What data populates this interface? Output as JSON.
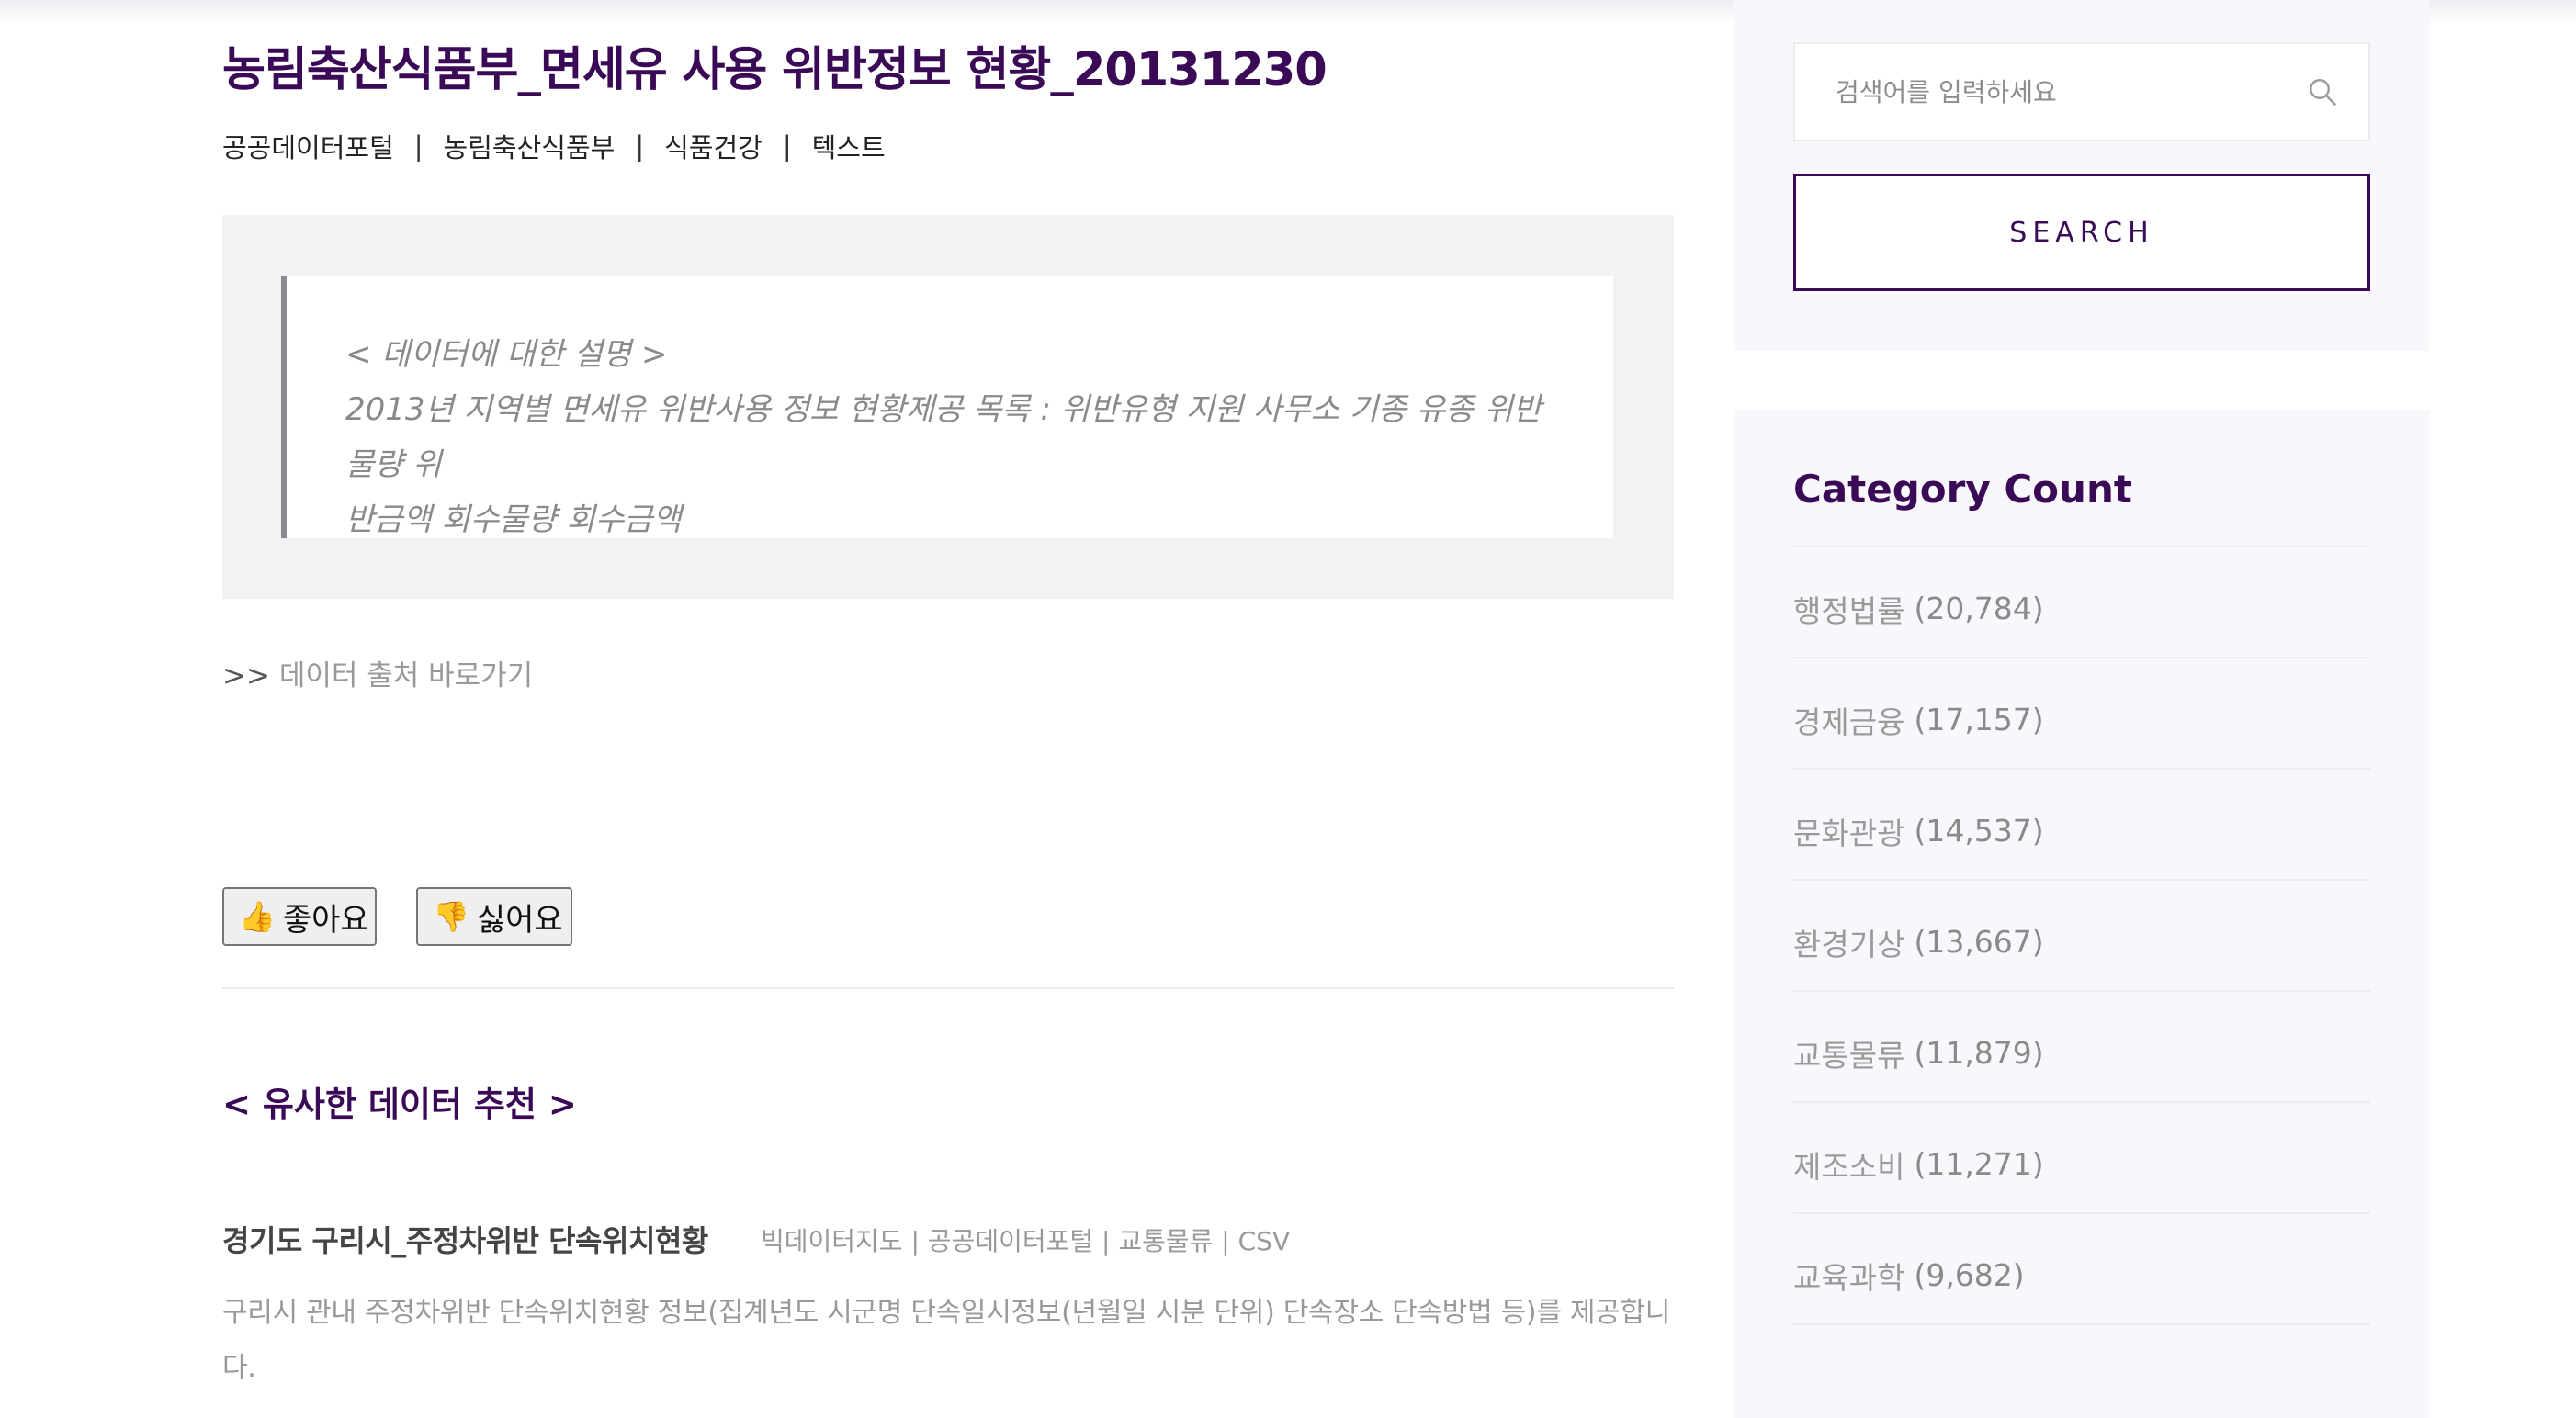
{
  "post": {
    "title": "농림축산식품부_면세유 사용 위반정보 현황_20131230",
    "meta": [
      "공공데이터포털",
      "농림축산식품부",
      "식품건강",
      "텍스트"
    ],
    "meta_separator": "|",
    "description_heading": "< 데이터에 대한 설명 >",
    "description_line1": "2013년 지역별 면세유 위반사용 정보 현황제공 목록 : 위반유형 지원 사무소 기종 유종 위반물량 위",
    "description_line2": "반금액 회수물량 회수금액",
    "source_arrow": ">>",
    "source_label": "데이터 출처 바로가기",
    "like_icon": "👍",
    "like_label": "좋아요",
    "dislike_icon": "👎",
    "dislike_label": "싫어요"
  },
  "recommend": {
    "heading": "< 유사한 데이터 추천 >",
    "items": [
      {
        "title": "경기도 구리시_주정차위반 단속위치현황",
        "meta": "빅데이터지도 | 공공데이터포털 | 교통물류 | CSV",
        "desc": "구리시 관내 주정차위반 단속위치현황 정보(집계년도 시군명 단속일시정보(년월일 시분 단위) 단속장소 단속방법 등)를 제공합니다."
      }
    ]
  },
  "sidebar": {
    "search": {
      "placeholder": "검색어를 입력하세요",
      "value": "",
      "button_label": "SEARCH",
      "icon": "search-icon"
    },
    "category": {
      "title": "Category Count",
      "items": [
        {
          "name": "행정법률",
          "count": "(20,784)"
        },
        {
          "name": "경제금융",
          "count": "(17,157)"
        },
        {
          "name": "문화관광",
          "count": "(14,537)"
        },
        {
          "name": "환경기상",
          "count": "(13,667)"
        },
        {
          "name": "교통물류",
          "count": "(11,879)"
        },
        {
          "name": "제조소비",
          "count": "(11,271)"
        },
        {
          "name": "교육과학",
          "count": "(9,682)"
        }
      ]
    }
  },
  "colors": {
    "accent": "#3a0a57",
    "panel": "#f8f7fb",
    "quote_bg": "#f2f2f5"
  }
}
